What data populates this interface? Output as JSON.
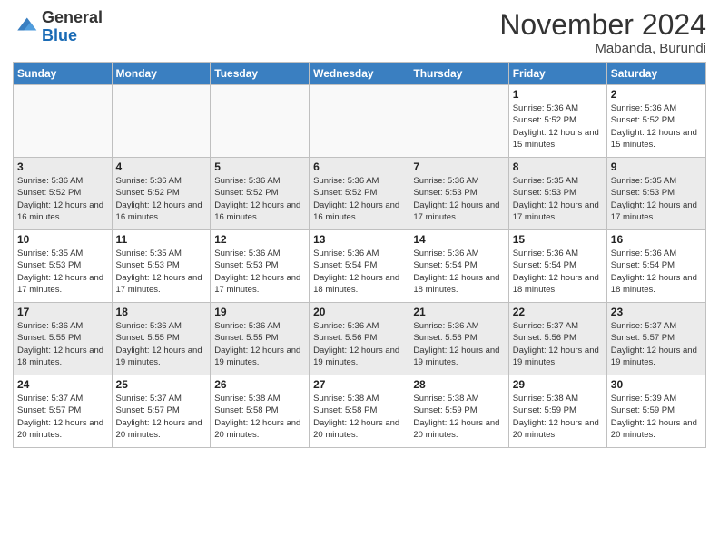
{
  "header": {
    "logo": {
      "line1": "General",
      "line2": "Blue"
    },
    "month": "November 2024",
    "location": "Mabanda, Burundi"
  },
  "weekdays": [
    "Sunday",
    "Monday",
    "Tuesday",
    "Wednesday",
    "Thursday",
    "Friday",
    "Saturday"
  ],
  "weeks": [
    [
      {
        "day": "",
        "sunrise": "",
        "sunset": "",
        "daylight": ""
      },
      {
        "day": "",
        "sunrise": "",
        "sunset": "",
        "daylight": ""
      },
      {
        "day": "",
        "sunrise": "",
        "sunset": "",
        "daylight": ""
      },
      {
        "day": "",
        "sunrise": "",
        "sunset": "",
        "daylight": ""
      },
      {
        "day": "",
        "sunrise": "",
        "sunset": "",
        "daylight": ""
      },
      {
        "day": "1",
        "sunrise": "Sunrise: 5:36 AM",
        "sunset": "Sunset: 5:52 PM",
        "daylight": "Daylight: 12 hours and 15 minutes."
      },
      {
        "day": "2",
        "sunrise": "Sunrise: 5:36 AM",
        "sunset": "Sunset: 5:52 PM",
        "daylight": "Daylight: 12 hours and 15 minutes."
      }
    ],
    [
      {
        "day": "3",
        "sunrise": "Sunrise: 5:36 AM",
        "sunset": "Sunset: 5:52 PM",
        "daylight": "Daylight: 12 hours and 16 minutes."
      },
      {
        "day": "4",
        "sunrise": "Sunrise: 5:36 AM",
        "sunset": "Sunset: 5:52 PM",
        "daylight": "Daylight: 12 hours and 16 minutes."
      },
      {
        "day": "5",
        "sunrise": "Sunrise: 5:36 AM",
        "sunset": "Sunset: 5:52 PM",
        "daylight": "Daylight: 12 hours and 16 minutes."
      },
      {
        "day": "6",
        "sunrise": "Sunrise: 5:36 AM",
        "sunset": "Sunset: 5:52 PM",
        "daylight": "Daylight: 12 hours and 16 minutes."
      },
      {
        "day": "7",
        "sunrise": "Sunrise: 5:36 AM",
        "sunset": "Sunset: 5:53 PM",
        "daylight": "Daylight: 12 hours and 17 minutes."
      },
      {
        "day": "8",
        "sunrise": "Sunrise: 5:35 AM",
        "sunset": "Sunset: 5:53 PM",
        "daylight": "Daylight: 12 hours and 17 minutes."
      },
      {
        "day": "9",
        "sunrise": "Sunrise: 5:35 AM",
        "sunset": "Sunset: 5:53 PM",
        "daylight": "Daylight: 12 hours and 17 minutes."
      }
    ],
    [
      {
        "day": "10",
        "sunrise": "Sunrise: 5:35 AM",
        "sunset": "Sunset: 5:53 PM",
        "daylight": "Daylight: 12 hours and 17 minutes."
      },
      {
        "day": "11",
        "sunrise": "Sunrise: 5:35 AM",
        "sunset": "Sunset: 5:53 PM",
        "daylight": "Daylight: 12 hours and 17 minutes."
      },
      {
        "day": "12",
        "sunrise": "Sunrise: 5:36 AM",
        "sunset": "Sunset: 5:53 PM",
        "daylight": "Daylight: 12 hours and 17 minutes."
      },
      {
        "day": "13",
        "sunrise": "Sunrise: 5:36 AM",
        "sunset": "Sunset: 5:54 PM",
        "daylight": "Daylight: 12 hours and 18 minutes."
      },
      {
        "day": "14",
        "sunrise": "Sunrise: 5:36 AM",
        "sunset": "Sunset: 5:54 PM",
        "daylight": "Daylight: 12 hours and 18 minutes."
      },
      {
        "day": "15",
        "sunrise": "Sunrise: 5:36 AM",
        "sunset": "Sunset: 5:54 PM",
        "daylight": "Daylight: 12 hours and 18 minutes."
      },
      {
        "day": "16",
        "sunrise": "Sunrise: 5:36 AM",
        "sunset": "Sunset: 5:54 PM",
        "daylight": "Daylight: 12 hours and 18 minutes."
      }
    ],
    [
      {
        "day": "17",
        "sunrise": "Sunrise: 5:36 AM",
        "sunset": "Sunset: 5:55 PM",
        "daylight": "Daylight: 12 hours and 18 minutes."
      },
      {
        "day": "18",
        "sunrise": "Sunrise: 5:36 AM",
        "sunset": "Sunset: 5:55 PM",
        "daylight": "Daylight: 12 hours and 19 minutes."
      },
      {
        "day": "19",
        "sunrise": "Sunrise: 5:36 AM",
        "sunset": "Sunset: 5:55 PM",
        "daylight": "Daylight: 12 hours and 19 minutes."
      },
      {
        "day": "20",
        "sunrise": "Sunrise: 5:36 AM",
        "sunset": "Sunset: 5:56 PM",
        "daylight": "Daylight: 12 hours and 19 minutes."
      },
      {
        "day": "21",
        "sunrise": "Sunrise: 5:36 AM",
        "sunset": "Sunset: 5:56 PM",
        "daylight": "Daylight: 12 hours and 19 minutes."
      },
      {
        "day": "22",
        "sunrise": "Sunrise: 5:37 AM",
        "sunset": "Sunset: 5:56 PM",
        "daylight": "Daylight: 12 hours and 19 minutes."
      },
      {
        "day": "23",
        "sunrise": "Sunrise: 5:37 AM",
        "sunset": "Sunset: 5:57 PM",
        "daylight": "Daylight: 12 hours and 19 minutes."
      }
    ],
    [
      {
        "day": "24",
        "sunrise": "Sunrise: 5:37 AM",
        "sunset": "Sunset: 5:57 PM",
        "daylight": "Daylight: 12 hours and 20 minutes."
      },
      {
        "day": "25",
        "sunrise": "Sunrise: 5:37 AM",
        "sunset": "Sunset: 5:57 PM",
        "daylight": "Daylight: 12 hours and 20 minutes."
      },
      {
        "day": "26",
        "sunrise": "Sunrise: 5:38 AM",
        "sunset": "Sunset: 5:58 PM",
        "daylight": "Daylight: 12 hours and 20 minutes."
      },
      {
        "day": "27",
        "sunrise": "Sunrise: 5:38 AM",
        "sunset": "Sunset: 5:58 PM",
        "daylight": "Daylight: 12 hours and 20 minutes."
      },
      {
        "day": "28",
        "sunrise": "Sunrise: 5:38 AM",
        "sunset": "Sunset: 5:59 PM",
        "daylight": "Daylight: 12 hours and 20 minutes."
      },
      {
        "day": "29",
        "sunrise": "Sunrise: 5:38 AM",
        "sunset": "Sunset: 5:59 PM",
        "daylight": "Daylight: 12 hours and 20 minutes."
      },
      {
        "day": "30",
        "sunrise": "Sunrise: 5:39 AM",
        "sunset": "Sunset: 5:59 PM",
        "daylight": "Daylight: 12 hours and 20 minutes."
      }
    ]
  ]
}
